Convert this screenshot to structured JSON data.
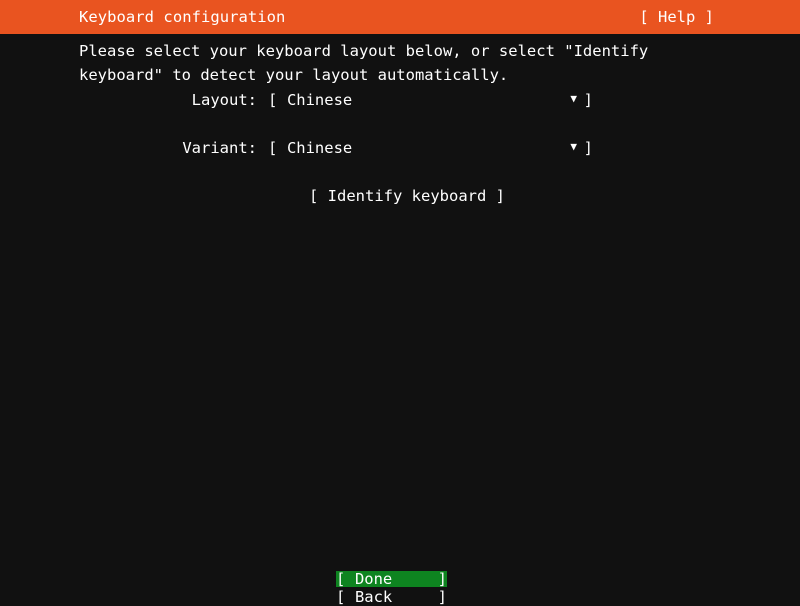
{
  "window": {
    "title": "Keyboard configuration",
    "accent_color": "#e95420",
    "background_color": "#111111",
    "highlight_color": "#0e8420",
    "text_color": "#ffffff"
  },
  "header": {
    "title": "Keyboard configuration",
    "help_label": "[ Help ]"
  },
  "main": {
    "intro": "Please select your keyboard layout below, or select \"Identify keyboard\" to detect your layout automatically.",
    "fields": [
      {
        "label": "Layout:",
        "value": "Chinese",
        "bracket_open": "[",
        "bracket_close": "]",
        "caret": "▼"
      },
      {
        "label": "Variant:",
        "value": "Chinese",
        "bracket_open": "[",
        "bracket_close": "]",
        "caret": "▼"
      }
    ],
    "identify_button": "[ Identify keyboard ]"
  },
  "footer": {
    "buttons": [
      {
        "bracket_open": "[",
        "label": "Done",
        "bracket_close": "]",
        "selected": true
      },
      {
        "bracket_open": "[",
        "label": "Back",
        "bracket_close": "]",
        "selected": false
      }
    ]
  }
}
